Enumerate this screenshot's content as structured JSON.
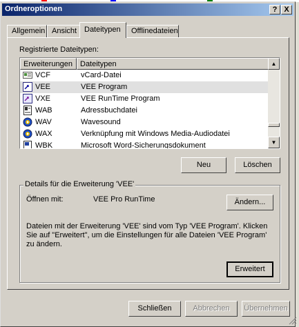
{
  "window": {
    "title": "Ordneroptionen",
    "help_button": "?",
    "close_button": "X"
  },
  "tabs": [
    {
      "label": "Allgemein",
      "active": false
    },
    {
      "label": "Ansicht",
      "active": false
    },
    {
      "label": "Dateitypen",
      "active": true
    },
    {
      "label": "Offlinedateien",
      "active": false
    }
  ],
  "filetypes": {
    "label": "Registrierte Dateitypen:",
    "columns": [
      "Erweiterungen",
      "Dateitypen"
    ],
    "rows": [
      {
        "ext": "VCF",
        "desc": "vCard-Datei",
        "icon": "vcard-icon"
      },
      {
        "ext": "VEE",
        "desc": "VEE Program",
        "icon": "vee-program-icon",
        "selected": true
      },
      {
        "ext": "VXE",
        "desc": "VEE RunTime Program",
        "icon": "vee-runtime-icon"
      },
      {
        "ext": "WAB",
        "desc": "Adressbuchdatei",
        "icon": "address-book-icon"
      },
      {
        "ext": "WAV",
        "desc": "Wavesound",
        "icon": "media-player-icon"
      },
      {
        "ext": "WAX",
        "desc": "Verknüpfung mit Windows Media-Audiodatei",
        "icon": "media-player-icon"
      },
      {
        "ext": "WBK",
        "desc": "Microsoft Word-Sicherungsdokument",
        "icon": "word-doc-icon"
      }
    ]
  },
  "buttons": {
    "new": "Neu",
    "delete": "Löschen",
    "change": "Ändern...",
    "advanced": "Erweitert",
    "close": "Schließen",
    "cancel": "Abbrechen",
    "apply": "Übernehmen"
  },
  "details": {
    "title": "Details für die Erweiterung 'VEE'",
    "open_with_label": "Öffnen mit:",
    "open_with_value": "VEE Pro RunTime",
    "info": "Dateien mit der Erweiterung 'VEE' sind vom Typ 'VEE Program'. Klicken Sie auf \"Erweitert\", um die Einstellungen für alle Dateien 'VEE Program' zu ändern."
  },
  "colors": {
    "title_gradient_start": "#0a246a",
    "title_gradient_end": "#a6caf0",
    "face": "#d4d0c8",
    "selection": "#e0e0e0"
  }
}
